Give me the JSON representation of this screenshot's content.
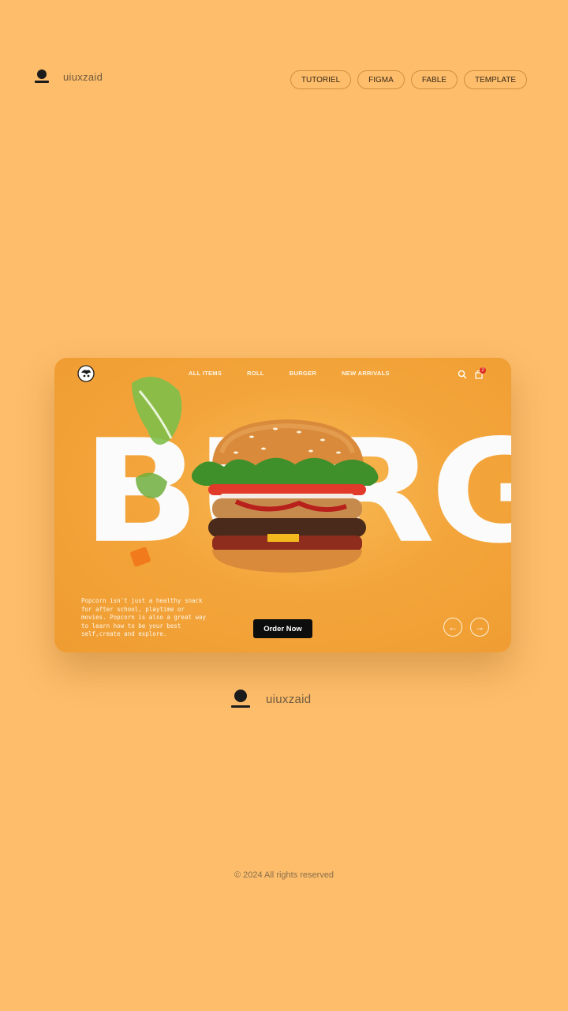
{
  "brand": {
    "name": "uiuxzaid",
    "icon": "user-icon"
  },
  "top_nav": [
    "TUTORIEL",
    "FIGMA",
    "FABLE",
    "TEMPLATE"
  ],
  "card": {
    "nav": [
      "ALL ITEMS",
      "ROLL",
      "BURGER",
      "NEW ARRIVALS"
    ],
    "cart_count": "2",
    "headline": "BURGER",
    "description": "Popcorn isn't just a healthy snack for after school, playtime or movies. Popcorn is also a great way to learn how to be your best self,create and explore.",
    "cta": "Order Now",
    "prev_arrow": "←",
    "next_arrow": "→",
    "colors": {
      "card_bg": "#f3a53b",
      "cta_bg": "#0d0d0d",
      "badge": "#e0261f"
    }
  },
  "footer": {
    "copyright": "© 2024 All rights reserved"
  }
}
